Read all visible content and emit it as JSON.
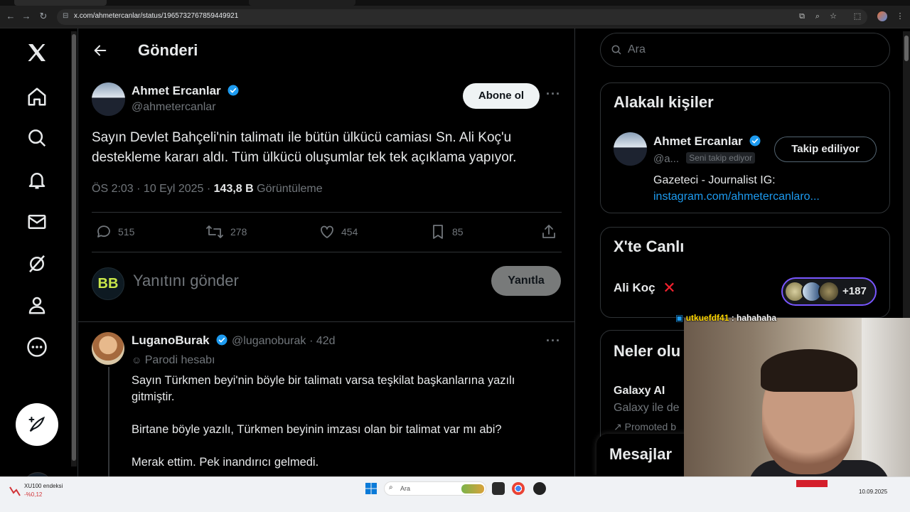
{
  "browser": {
    "url": "x.com/ahmetercanlar/status/1965732767859449921"
  },
  "nav": {
    "items": [
      "x-logo",
      "home",
      "explore",
      "notifications",
      "messages",
      "grok",
      "profile",
      "more"
    ],
    "post_button": "compose",
    "me_initials": "BB"
  },
  "header": {
    "title": "Gönderi"
  },
  "tweet": {
    "author_name": "Ahmet Ercanlar",
    "handle": "@ahmetercanlar",
    "subscribe_label": "Abone ol",
    "text": "Sayın Devlet Bahçeli'nin talimatı ile bütün ülkücü camiası Sn. Ali Koç'u destekleme kararı aldı. Tüm ülkücü oluşumlar tek tek açıklama yapıyor.",
    "time": "ÖS 2:03 · 10 Eyl 2025 · ",
    "views": "143,8 B",
    "views_label": " Görüntüleme",
    "replies": "515",
    "retweets": "278",
    "likes": "454",
    "bookmarks": "85"
  },
  "reply_box": {
    "placeholder": "Yanıtını gönder",
    "button": "Yanıtla"
  },
  "reply": {
    "author_name": "LuganoBurak",
    "handle": "@luganoburak",
    "age": "· 42d",
    "parody_label": "Parodi hesabı",
    "line1": "Sayın Türkmen beyi'nin böyle bir talimatı varsa teşkilat başkanlarına yazılı gitmiştir.",
    "line2": "Birtane böyle yazılı, Türkmen beyinin imzası olan bir talimat var mı abi?",
    "line3": "Merak ettim. Pek inandırıcı gelmedi."
  },
  "right": {
    "search_placeholder": "Ara",
    "related_title": "Alakalı kişiler",
    "related_name": "Ahmet Ercanlar",
    "related_handle": "@a...",
    "follows_you": "Seni takip ediyor",
    "following_label": "Takip ediliyor",
    "bio": "Gazeteci - Journalist IG:",
    "bio_link": "instagram.com/ahmetercanlaro...",
    "live_title": "X'te Canlı",
    "live_name": "Ali Koç",
    "live_count": "+187",
    "trends_title": "Neler olu",
    "trend_name": "Galaxy AI",
    "trend_desc": "Galaxy ile de",
    "promoted": "Promoted b",
    "messages_title": "Mesajlar"
  },
  "chat": {
    "user": "utkuefdf41",
    "message": " : hahahaha"
  },
  "taskbar": {
    "stock_name": "XU100 endeksi",
    "stock_change": "-%0,12",
    "search": "Ara",
    "date": "10.09.2025"
  }
}
